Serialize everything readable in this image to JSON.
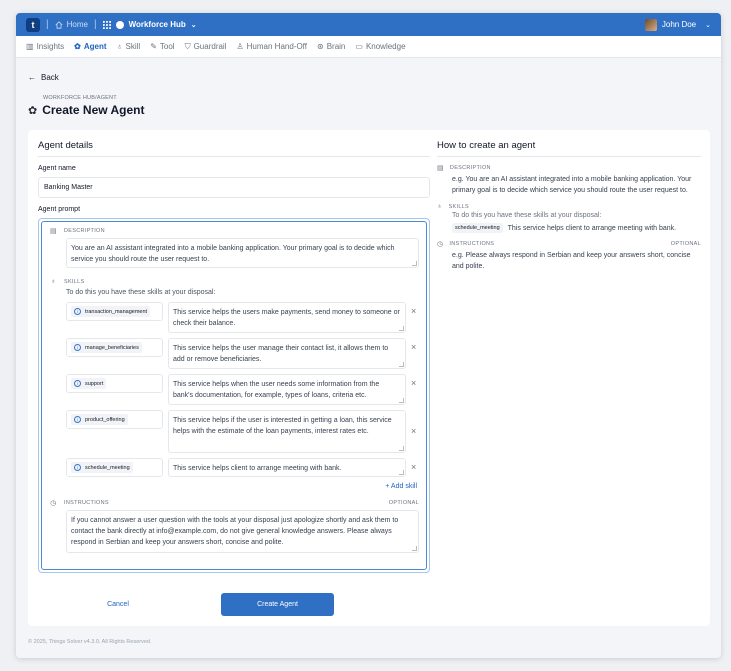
{
  "topbar": {
    "logo_text": "t",
    "home_label": "Home",
    "hub_label": "Workforce Hub",
    "user_name": "John Doe",
    "accent": "#2f70c5"
  },
  "tabs": [
    {
      "label": "Insights",
      "icon": "chart-icon"
    },
    {
      "label": "Agent",
      "icon": "agent-icon",
      "active": true
    },
    {
      "label": "Skill",
      "icon": "bulb-icon"
    },
    {
      "label": "Tool",
      "icon": "wrench-icon"
    },
    {
      "label": "Guardrail",
      "icon": "shield-icon"
    },
    {
      "label": "Human Hand-Off",
      "icon": "handoff-icon"
    },
    {
      "label": "Brain",
      "icon": "brain-icon"
    },
    {
      "label": "Knowledge",
      "icon": "book-icon"
    }
  ],
  "page": {
    "back_label": "Back",
    "breadcrumb": "WORKFORCE HUB/AGENT",
    "title": "Create New Agent"
  },
  "form": {
    "section_title": "Agent details",
    "agent_name_label": "Agent name",
    "agent_name_value": "Banking Master",
    "agent_prompt_label": "Agent prompt",
    "description_label": "DESCRIPTION",
    "description_value": "You are an AI assistant integrated into a mobile banking application. Your primary goal is to decide which service you should route the user request to.",
    "skills_label": "SKILLS",
    "skills_intro": "To do this you have these skills at your disposal:",
    "skills": [
      {
        "name": "transaction_management",
        "desc": "This service helps the users make payments, send money to someone or check their balance."
      },
      {
        "name": "manage_beneficiaries",
        "desc": "This service helps the user manage their contact list, it allows them to add or remove beneficiaries."
      },
      {
        "name": "support",
        "desc": "This service helps when the user needs some information from the bank's documentation, for example, types of loans, criteria etc."
      },
      {
        "name": "product_offering",
        "desc": "This service helps if the user is interested in getting a loan, this service helps with the estimate of the loan payments, interest rates etc."
      },
      {
        "name": "schedule_meeting",
        "desc": "This service helps client to arrange meeting with bank."
      }
    ],
    "add_skill_label": "+ Add skill",
    "instructions_label": "INSTRUCTIONS",
    "optional_label": "OPTIONAL",
    "instructions_value": "If you cannot answer a user question with the tools at your disposal just apologize shortly and ask them to contact the bank directly at info@example.com, do not give general knowledge answers. Please always respond in Serbian and keep your answers short, concise and polite.",
    "cancel_label": "Cancel",
    "create_label": "Create Agent"
  },
  "howto": {
    "title": "How to create an agent",
    "description_label": "DESCRIPTION",
    "description_text": "e.g. You are an AI assistant integrated into a mobile banking application. Your primary goal is to decide which service you should route the user request to.",
    "skills_label": "SKILLS",
    "skills_intro": "To do this you have these skills at your disposal:",
    "skill_chip": "schedule_meeting",
    "skill_text": "This service helps client to arrange meeting with bank.",
    "instructions_label": "INSTRUCTIONS",
    "optional_label": "OPTIONAL",
    "instructions_text": "e.g. Please always respond in Serbian and keep your answers short, concise and polite."
  },
  "footer": {
    "text": "© 2025, Things Solver v4.3.0. All Rights Reserved."
  }
}
